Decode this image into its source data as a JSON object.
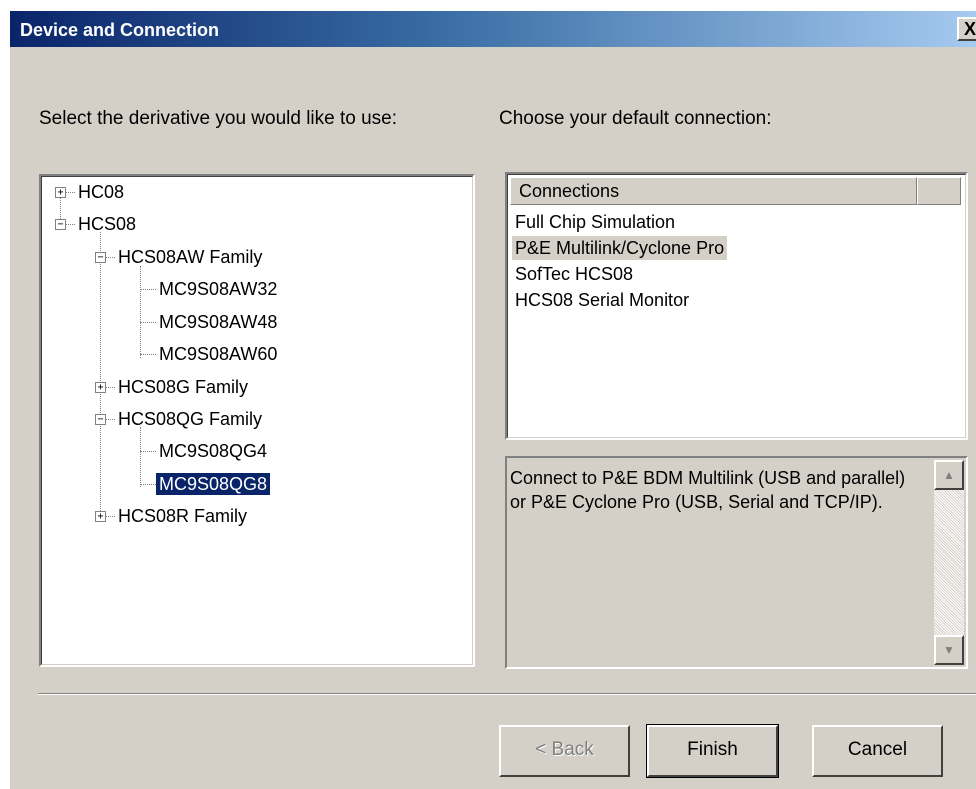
{
  "window": {
    "title": "Device and Connection",
    "close_glyph": "X"
  },
  "derivative": {
    "label": "Select the derivative you would like to use:",
    "tree": [
      {
        "label": "HC08",
        "expander": "+"
      },
      {
        "label": "HCS08",
        "expander": "−"
      },
      {
        "label": "HCS08AW Family",
        "expander": "−"
      },
      {
        "label": "MC9S08AW32"
      },
      {
        "label": "MC9S08AW48"
      },
      {
        "label": "MC9S08AW60"
      },
      {
        "label": "HCS08G Family",
        "expander": "+"
      },
      {
        "label": "HCS08QG Family",
        "expander": "−"
      },
      {
        "label": "MC9S08QG4"
      },
      {
        "label": "MC9S08QG8",
        "selected": true
      },
      {
        "label": "HCS08R Family",
        "expander": "+"
      }
    ]
  },
  "connection": {
    "label": "Choose your default connection:",
    "header": "Connections",
    "items": [
      {
        "label": "Full Chip Simulation"
      },
      {
        "label": "P&E Multilink/Cyclone Pro",
        "highlighted": true
      },
      {
        "label": "SofTec HCS08"
      },
      {
        "label": "HCS08 Serial Monitor"
      }
    ],
    "description": "Connect to P&E BDM Multilink (USB and parallel) or P&E Cyclone Pro (USB, Serial and TCP/IP).",
    "scroll_up_glyph": "▲",
    "scroll_down_glyph": "▼"
  },
  "buttons": {
    "back": "< Back",
    "finish": "Finish",
    "cancel": "Cancel"
  },
  "colors": {
    "window_bg": "#d4d0c8",
    "title_start": "#0a246a",
    "title_end": "#a6caf0",
    "selection": "#0a246a"
  }
}
